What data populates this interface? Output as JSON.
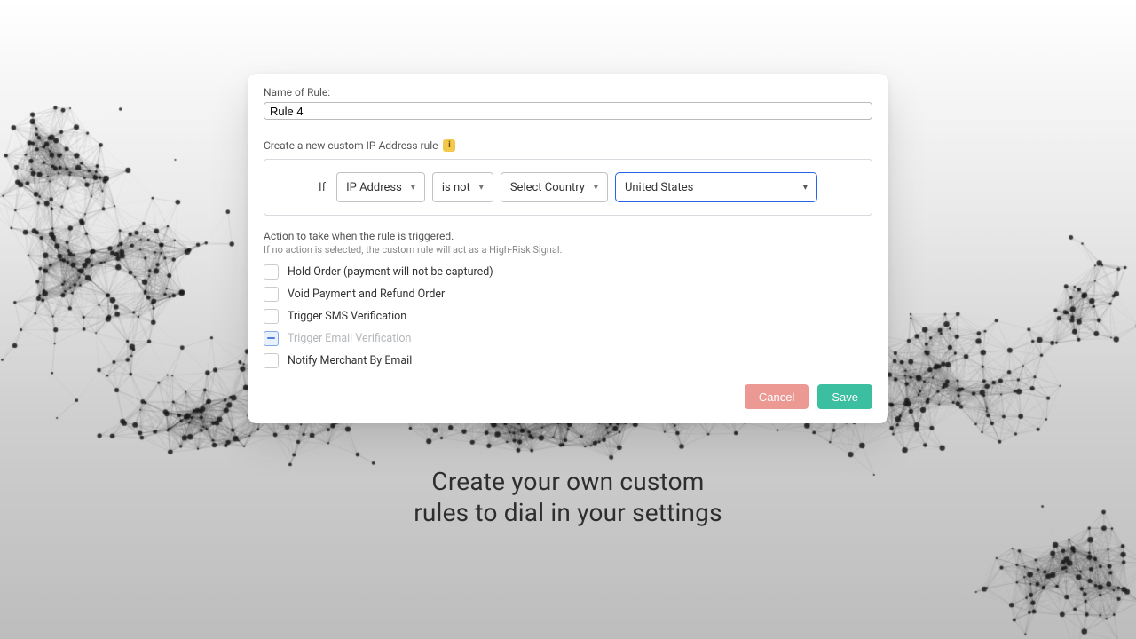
{
  "form": {
    "name_label": "Name of Rule:",
    "name_value": "Rule 4",
    "builder_label": "Create a new custom IP Address rule",
    "info_glyph": "i",
    "if_label": "If",
    "select_field": "IP Address",
    "select_operator": "is not",
    "select_target": "Select Country",
    "select_value": "United States"
  },
  "actions": {
    "heading": "Action to take when the rule is triggered.",
    "subheading": "If no action is selected, the custom rule will act as a High-Risk Signal.",
    "items": [
      {
        "label": "Hold Order (payment will not be captured)",
        "state": "unchecked"
      },
      {
        "label": "Void Payment and Refund Order",
        "state": "unchecked"
      },
      {
        "label": "Trigger SMS Verification",
        "state": "unchecked"
      },
      {
        "label": "Trigger Email Verification",
        "state": "indeterminate"
      },
      {
        "label": "Notify Merchant By Email",
        "state": "unchecked"
      }
    ]
  },
  "buttons": {
    "cancel": "Cancel",
    "save": "Save"
  },
  "hero": {
    "line1": "Create your own custom",
    "line2": "rules to dial in your settings"
  },
  "colors": {
    "accent_blue": "#2563eb",
    "save_green": "#3bbfa0",
    "cancel_red": "#ec9994",
    "info_yellow": "#f3c84b"
  }
}
